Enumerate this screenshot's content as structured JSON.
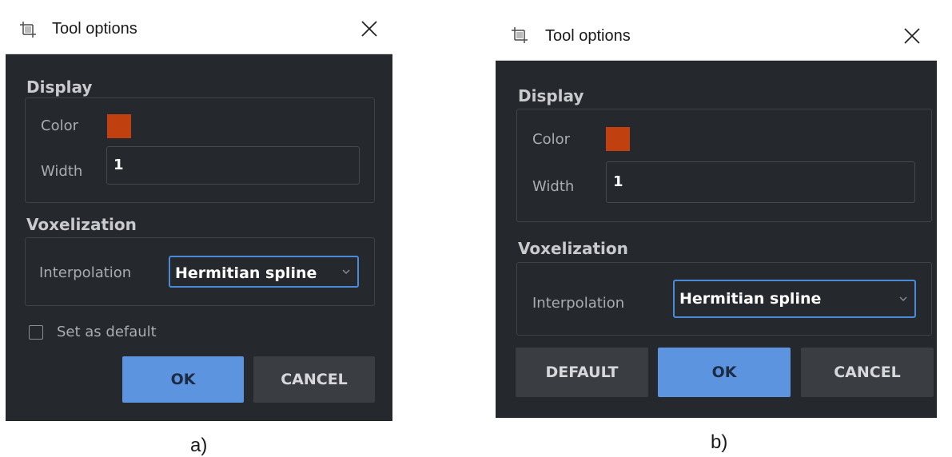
{
  "panel_a": {
    "caption": "a)",
    "window_title": "Tool options",
    "display_section": "Display",
    "color_label": "Color",
    "color_value": "#c04010",
    "width_label": "Width",
    "width_value": "1",
    "voxelization_section": "Voxelization",
    "interpolation_label": "Interpolation",
    "interpolation_value": "Hermitian spline",
    "set_default_label": "Set as default",
    "set_default_checked": false,
    "ok_label": "OK",
    "cancel_label": "CANCEL"
  },
  "panel_b": {
    "caption": "b)",
    "window_title": "Tool options",
    "display_section": "Display",
    "color_label": "Color",
    "color_value": "#c04010",
    "width_label": "Width",
    "width_value": "1",
    "voxelization_section": "Voxelization",
    "interpolation_label": "Interpolation",
    "interpolation_value": "Hermitian spline",
    "default_label": "DEFAULT",
    "ok_label": "OK",
    "cancel_label": "CANCEL"
  },
  "icons": {
    "app": "crop-frame-icon",
    "close": "close-icon",
    "dropdown": "chevron-down-icon"
  }
}
